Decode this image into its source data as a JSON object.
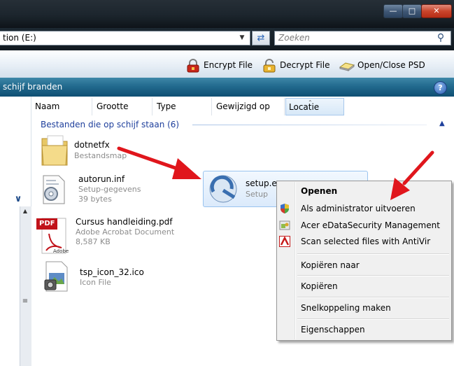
{
  "window": {
    "address_text": "tion (E:)",
    "search_placeholder": "Zoeken"
  },
  "toolbar": {
    "encrypt_label": "Encrypt File",
    "decrypt_label": "Decrypt File",
    "openclose_label": "Open/Close PSD"
  },
  "burnbar": {
    "label": "schijf branden",
    "help_label": "?"
  },
  "columns": [
    {
      "label": "Naam"
    },
    {
      "label": "Grootte"
    },
    {
      "label": "Type"
    },
    {
      "label": "Gewijzigd op"
    },
    {
      "label": "Locatie"
    }
  ],
  "group": {
    "title": "Bestanden die op schijf staan (6)"
  },
  "files": [
    {
      "name": "dotnetfx",
      "sub1": "Bestandsmap",
      "icon": "folder-icon"
    },
    {
      "name": "autorun.inf",
      "sub1": "Setup-gegevens",
      "sub2": "39 bytes",
      "icon": "settings-file-icon"
    },
    {
      "name": "setup.e",
      "sub1": "Setup",
      "icon": "setup-icon"
    },
    {
      "name": "Cursus handleiding.pdf",
      "sub1": "Adobe Acrobat Document",
      "sub2": "8,587 KB",
      "icon": "pdf-icon"
    },
    {
      "name": "tsp_icon_32.ico",
      "sub1": "Icon File",
      "icon": "image-file-icon"
    }
  ],
  "pdf_badge": "PDF",
  "pdf_brand": "Adobe",
  "context_menu": {
    "items": [
      {
        "label": "Openen"
      },
      {
        "label": "Als administrator uitvoeren"
      },
      {
        "label": "Acer eDataSecurity Management"
      },
      {
        "label": "Scan selected files with AntiVir"
      },
      {
        "label": "Kopiëren naar"
      },
      {
        "label": "Kopiëren"
      },
      {
        "label": "Snelkoppeling maken"
      },
      {
        "label": "Eigenschappen"
      }
    ]
  },
  "colors": {
    "accent_blue": "#1e3f9c",
    "arrow_red": "#e0161c",
    "burnbar": "#226a8e"
  }
}
